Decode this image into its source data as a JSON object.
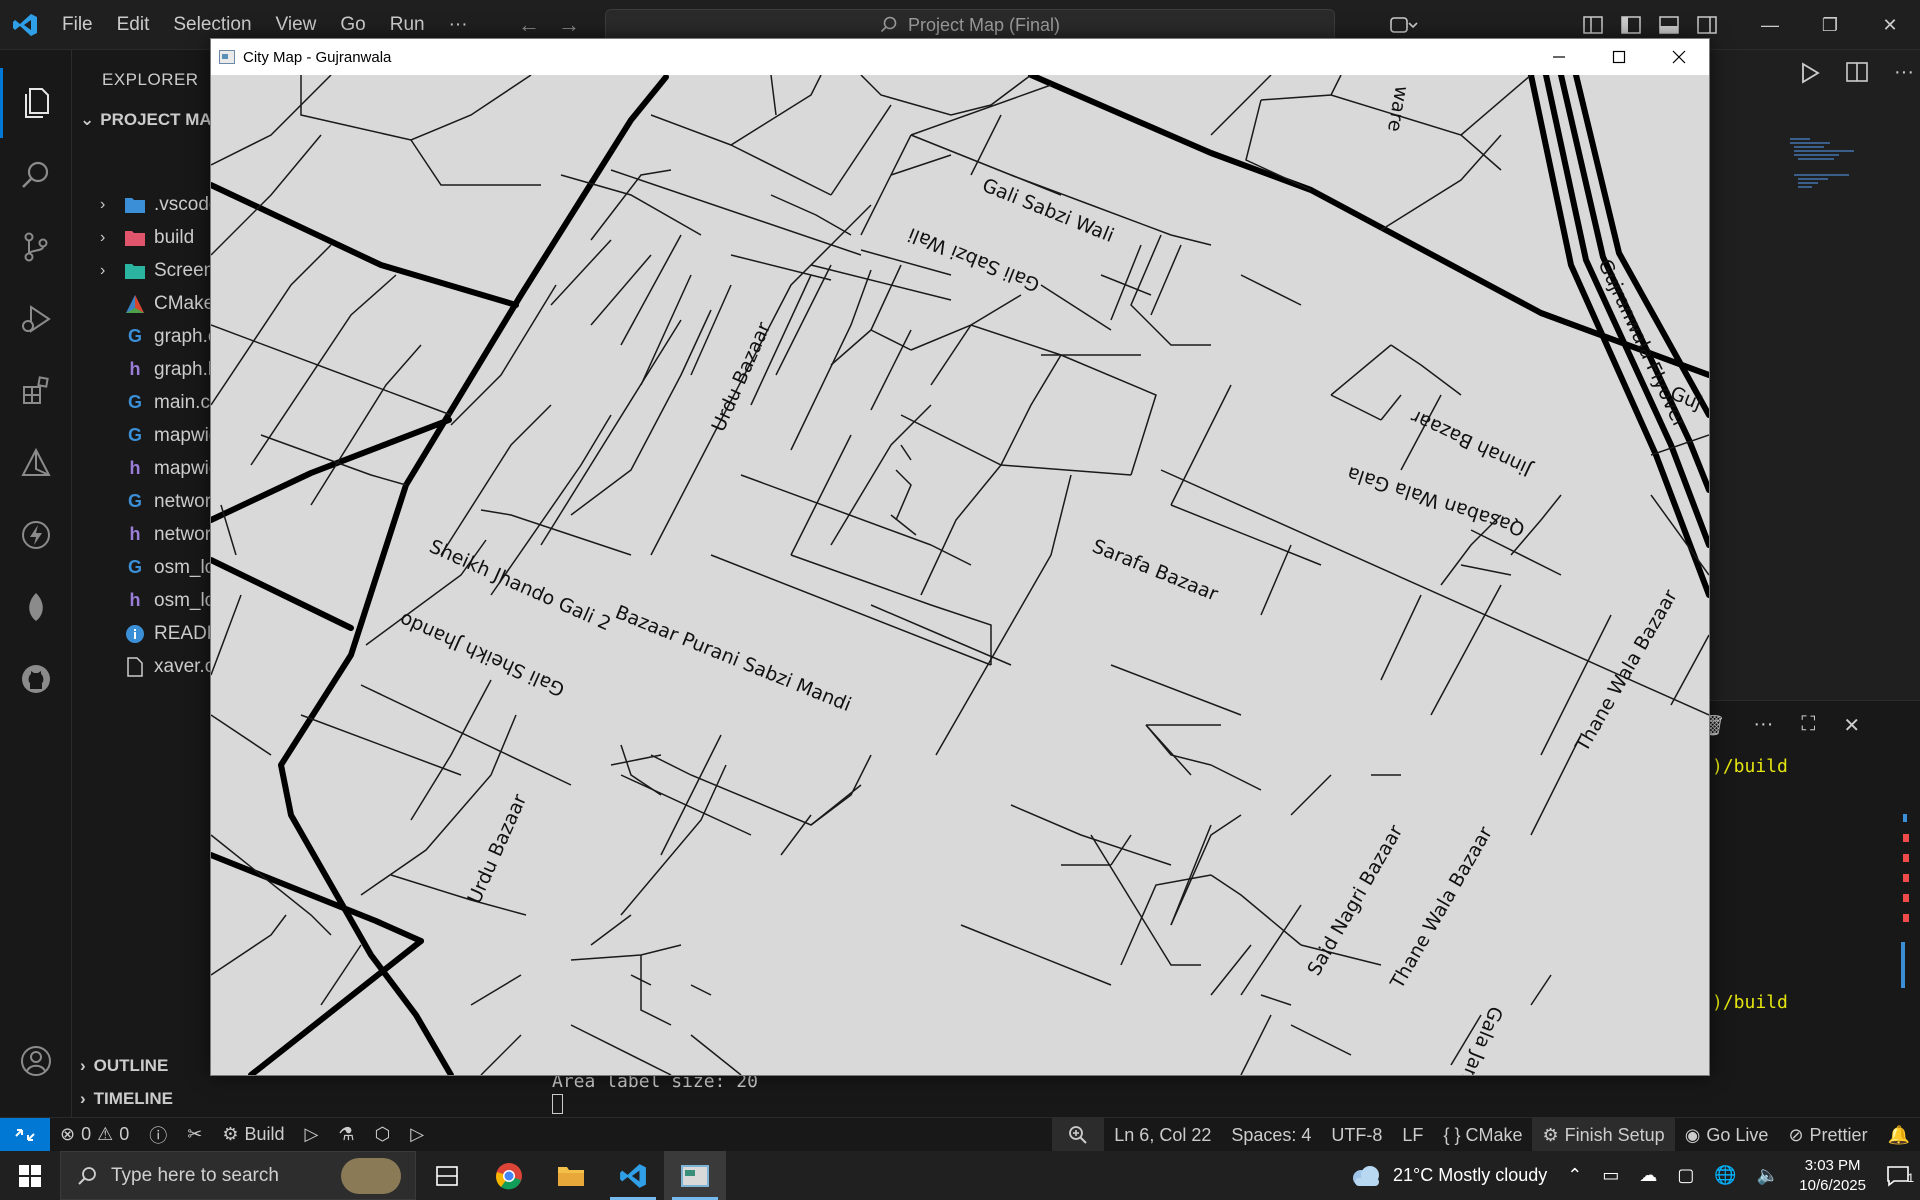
{
  "titlebar": {
    "menu": [
      "File",
      "Edit",
      "Selection",
      "View",
      "Go",
      "Run",
      "···"
    ],
    "command_center": "Project Map (Final)"
  },
  "explorer": {
    "title": "EXPLORER",
    "section": "PROJECT MAP",
    "items": [
      {
        "label": ".vscode",
        "icon": "vscode-folder-icon",
        "kind": "folder"
      },
      {
        "label": "build",
        "icon": "build-folder-icon",
        "kind": "folder"
      },
      {
        "label": "Screenshots",
        "icon": "images-folder-icon",
        "kind": "folder"
      },
      {
        "label": "CMakeLists.txt",
        "icon": "cmake-icon",
        "kind": "file"
      },
      {
        "label": "graph.cpp",
        "icon": "cpp-file-icon",
        "kind": "file"
      },
      {
        "label": "graph.h",
        "icon": "header-file-icon",
        "kind": "file"
      },
      {
        "label": "main.cpp",
        "icon": "cpp-file-icon",
        "kind": "file"
      },
      {
        "label": "mapwidget.cpp",
        "icon": "cpp-file-icon",
        "kind": "file"
      },
      {
        "label": "mapwidget.h",
        "icon": "header-file-icon",
        "kind": "file"
      },
      {
        "label": "network.cpp",
        "icon": "cpp-file-icon",
        "kind": "file"
      },
      {
        "label": "network.h",
        "icon": "header-file-icon",
        "kind": "file"
      },
      {
        "label": "osm_loader.cpp",
        "icon": "cpp-file-icon",
        "kind": "file"
      },
      {
        "label": "osm_loader.h",
        "icon": "header-file-icon",
        "kind": "file"
      },
      {
        "label": "README.md",
        "icon": "info-icon",
        "kind": "file"
      },
      {
        "label": "xaver.osm",
        "icon": "file-icon",
        "kind": "file"
      }
    ],
    "outline": "OUTLINE",
    "timeline": "TIMELINE"
  },
  "terminal": {
    "line_build_1": ")/build",
    "line_build_2": ")/build",
    "line_area": "Area label size: 20"
  },
  "statusbar": {
    "errors": "0",
    "warnings": "0",
    "build": "Build",
    "position": "Ln 6, Col 22",
    "spaces": "Spaces: 4",
    "encoding": "UTF-8",
    "eol": "LF",
    "language": "{ } CMake",
    "finish_setup": "Finish Setup",
    "go_live": "Go Live",
    "prettier": "Prettier"
  },
  "taskbar": {
    "search_placeholder": "Type here to search",
    "weather": "21°C  Mostly cloudy",
    "time": "3:03 PM",
    "date": "10/6/2025",
    "notifications": "1"
  },
  "map_window": {
    "title": "City Map - Gujranwala",
    "labels": {
      "gali_sabzi_wali": "Gali Sabzi Wali",
      "urdu_bazaar_1": "Urdu Bazaar",
      "urdu_bazaar_2": "Urdu Bazaar",
      "jinnah_bazaar": "Jinnah Bazaar",
      "qasaban_wala_gala": "Qasaban Wala Gala",
      "sarafa_bazaar": "Sarafa Bazaar",
      "sheikh_jhando_gali_2": "Sheikh Jhando Gali 2",
      "gali_sheikh_jhando": "Gali Sheikh Jhando",
      "bazaar_purani_sabzi_mandi": "Bazaar Purani Sabzi Mandi",
      "thane_wala_bazaar_1": "Thane Wala Bazaar",
      "thane_wala_bazaar_2": "Thane Wala Bazaar",
      "said_nagri_bazaar": "Said Nagri Bazaar",
      "gala_jamia_masjid": "Gala Jamia Masjid",
      "gujranwala_flyover": "Gujranwala Flyover",
      "guj_partial": "Guj",
      "upside_label": "Gali Sabzi Wali",
      "ware_partial": "ware"
    }
  },
  "colors": {
    "accent": "#0078d4",
    "map_background": "#d9d9d9",
    "terminal_yellow": "#e5e510"
  }
}
